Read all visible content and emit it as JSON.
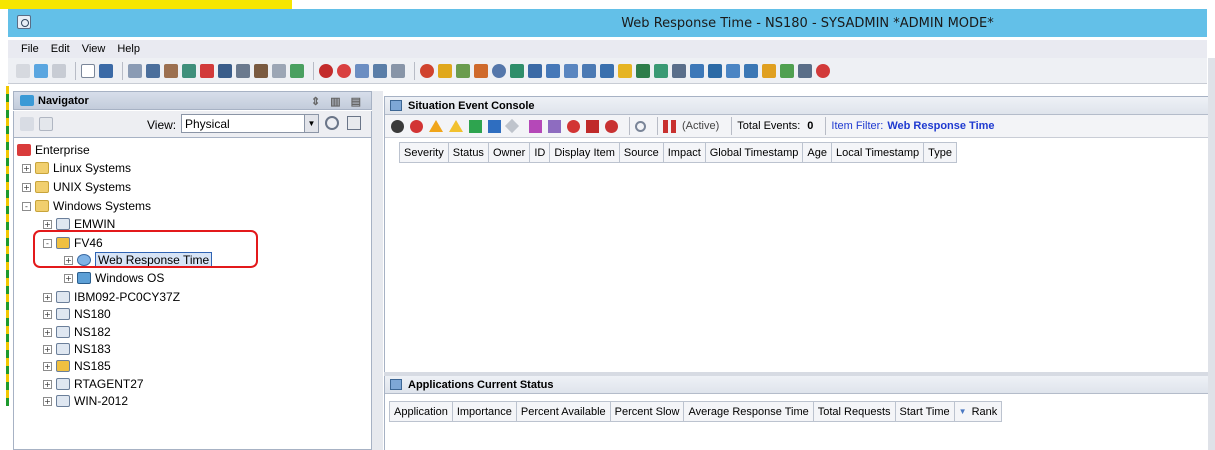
{
  "window": {
    "title": "Web Response Time - NS180 - SYSADMIN   *ADMIN MODE*"
  },
  "menu": [
    "File",
    "Edit",
    "View",
    "Help"
  ],
  "navigator": {
    "title": "Navigator",
    "view_label": "View:",
    "view_value": "Physical",
    "tree": [
      {
        "label": "Enterprise",
        "icon": "enterprise-icon",
        "level": 0,
        "expander": ""
      },
      {
        "label": "Linux Systems",
        "icon": "linux-folder-icon",
        "level": 1,
        "expander": "+"
      },
      {
        "label": "UNIX Systems",
        "icon": "folder-icon",
        "level": 1,
        "expander": "+"
      },
      {
        "label": "Windows Systems",
        "icon": "windows-folder-icon",
        "level": 1,
        "expander": "-"
      },
      {
        "label": "EMWIN",
        "icon": "computer-icon",
        "level": 2,
        "expander": "+"
      },
      {
        "label": "FV46",
        "icon": "computer-alert-icon",
        "level": 2,
        "expander": "-"
      },
      {
        "label": "Web Response Time",
        "icon": "web-response-icon",
        "level": 3,
        "expander": "+",
        "selected": true
      },
      {
        "label": "Windows OS",
        "icon": "windows-os-icon",
        "level": 3,
        "expander": "+"
      },
      {
        "label": "IBM092-PC0CY37Z",
        "icon": "computer-icon",
        "level": 2,
        "expander": "+"
      },
      {
        "label": "NS180",
        "icon": "computer-icon",
        "level": 2,
        "expander": "+"
      },
      {
        "label": "NS182",
        "icon": "computer-icon",
        "level": 2,
        "expander": "+"
      },
      {
        "label": "NS183",
        "icon": "computer-icon",
        "level": 2,
        "expander": "+"
      },
      {
        "label": "NS185",
        "icon": "computer-alert-icon",
        "level": 2,
        "expander": "+"
      },
      {
        "label": "RTAGENT27",
        "icon": "computer-icon",
        "level": 2,
        "expander": "+"
      },
      {
        "label": "WIN-2012",
        "icon": "computer-icon",
        "level": 2,
        "expander": "+"
      }
    ]
  },
  "console": {
    "title": "Situation Event Console",
    "active_label": "(Active)",
    "total_events_label": "Total Events:",
    "total_events_value": "0",
    "item_filter_label": "Item Filter:",
    "item_filter_value": "Web Response Time",
    "columns": [
      "Severity",
      "Status",
      "Owner",
      "ID",
      "Display Item",
      "Source",
      "Impact",
      "Global Timestamp",
      "Age",
      "Local Timestamp",
      "Type"
    ]
  },
  "apps": {
    "title": "Applications Current Status",
    "columns": [
      "Application",
      "Importance",
      "Percent Available",
      "Percent Slow",
      "Average Response Time",
      "Total Requests",
      "Start Time",
      "Rank"
    ]
  },
  "colors": {
    "titlebar": "#63c0e8",
    "highlight_box": "#e3191b",
    "filter_text": "#1f3ad0"
  }
}
